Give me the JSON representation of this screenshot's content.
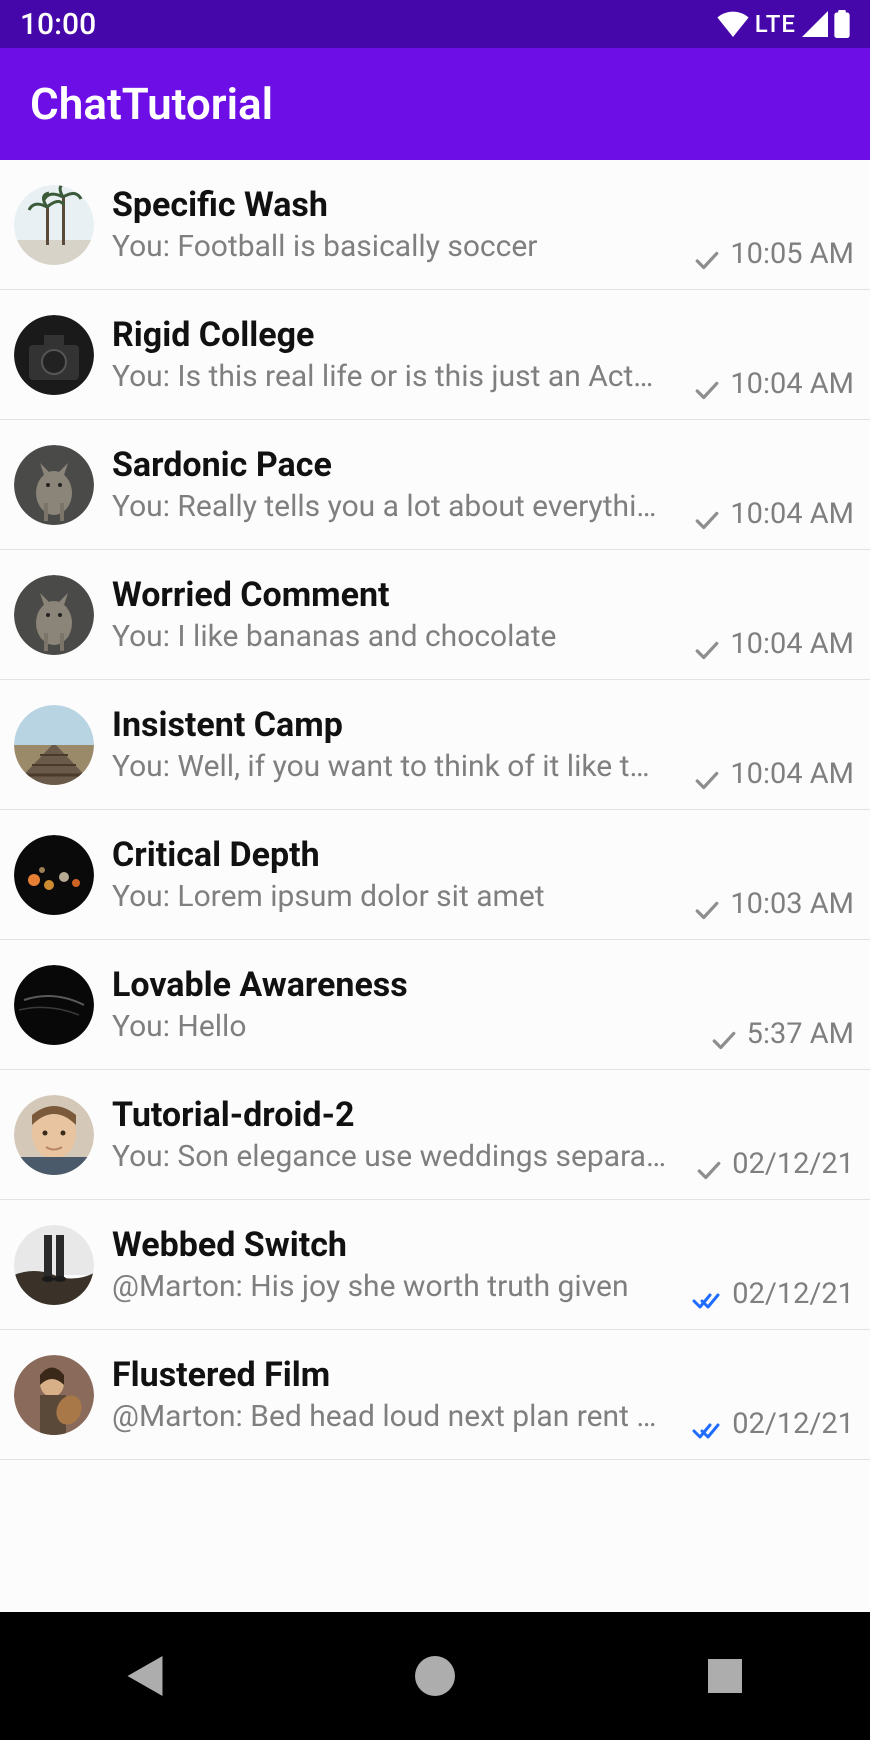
{
  "status": {
    "time": "10:00",
    "network": "LTE"
  },
  "app": {
    "title": "ChatTutorial"
  },
  "chats": [
    {
      "name": "Specific Wash",
      "preview": "You: Football is basically soccer",
      "time": "10:05 AM",
      "status": "sent"
    },
    {
      "name": "Rigid College",
      "preview": "You: Is this real life or is this just an Act…",
      "time": "10:04 AM",
      "status": "sent"
    },
    {
      "name": "Sardonic Pace",
      "preview": "You: Really tells you a lot about everythi…",
      "time": "10:04 AM",
      "status": "sent"
    },
    {
      "name": "Worried Comment",
      "preview": "You: I like bananas and chocolate",
      "time": "10:04 AM",
      "status": "sent"
    },
    {
      "name": "Insistent Camp",
      "preview": "You: Well, if you want to think of it like t…",
      "time": "10:04 AM",
      "status": "sent"
    },
    {
      "name": "Critical Depth",
      "preview": "You: Lorem ipsum dolor sit amet",
      "time": "10:03 AM",
      "status": "sent"
    },
    {
      "name": "Lovable Awareness",
      "preview": "You: Hello",
      "time": "5:37 AM",
      "status": "sent"
    },
    {
      "name": "Tutorial-droid-2",
      "preview": "You: Son elegance use weddings separa…",
      "time": "02/12/21",
      "status": "sent"
    },
    {
      "name": "Webbed Switch",
      "preview": "@Marton: His joy she worth truth given",
      "time": "02/12/21",
      "status": "read"
    },
    {
      "name": "Flustered Film",
      "preview": "@Marton: Bed head loud next plan rent …",
      "time": "02/12/21",
      "status": "read"
    }
  ],
  "colors": {
    "statusBar": "#4507a9",
    "appBar": "#6e0ee6",
    "readCheck": "#1f6cff",
    "sentCheck": "#8e8e8e"
  }
}
